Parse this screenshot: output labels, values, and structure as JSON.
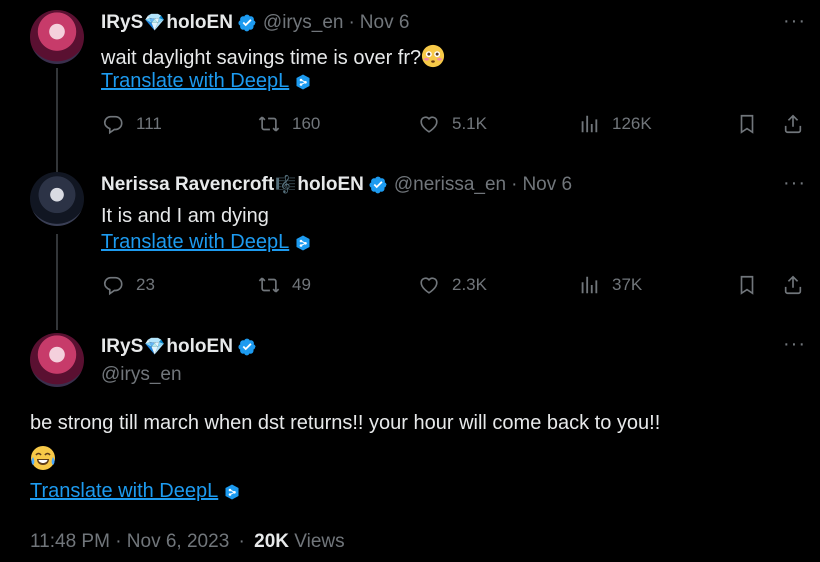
{
  "tweet1": {
    "name": "IRyS",
    "name_suffix": "holoEN",
    "handle": "@irys_en",
    "date": "Nov 6",
    "text": "wait daylight savings time is over fr?",
    "emoji": "flushed-face",
    "translate_label": "Translate with DeepL",
    "replies": "111",
    "reposts": "160",
    "likes": "5.1K",
    "views": "126K"
  },
  "tweet2": {
    "name": "Nerissa Ravencroft",
    "name_suffix": "holoEN",
    "handle": "@nerissa_en",
    "date": "Nov 6",
    "text": "It is and I am dying",
    "translate_label": "Translate with DeepL",
    "replies": "23",
    "reposts": "49",
    "likes": "2.3K",
    "views": "37K"
  },
  "tweet3": {
    "name": "IRyS",
    "name_suffix": "holoEN",
    "handle": "@irys_en",
    "text": "be strong till march when dst returns!! your hour will come back to you!!",
    "emoji": "face-with-tears-of-joy",
    "translate_label": "Translate with DeepL",
    "timestamp": "11:48 PM · Nov 6, 2023",
    "dot": "·",
    "view_count": "20K",
    "views_label": "Views"
  },
  "separator_dot": "·",
  "more_glyph": "···",
  "colors": {
    "background": "#000000",
    "text": "#e7e9ea",
    "muted": "#71767b",
    "link": "#1d9bf0",
    "verified": "#1d9bf0"
  }
}
